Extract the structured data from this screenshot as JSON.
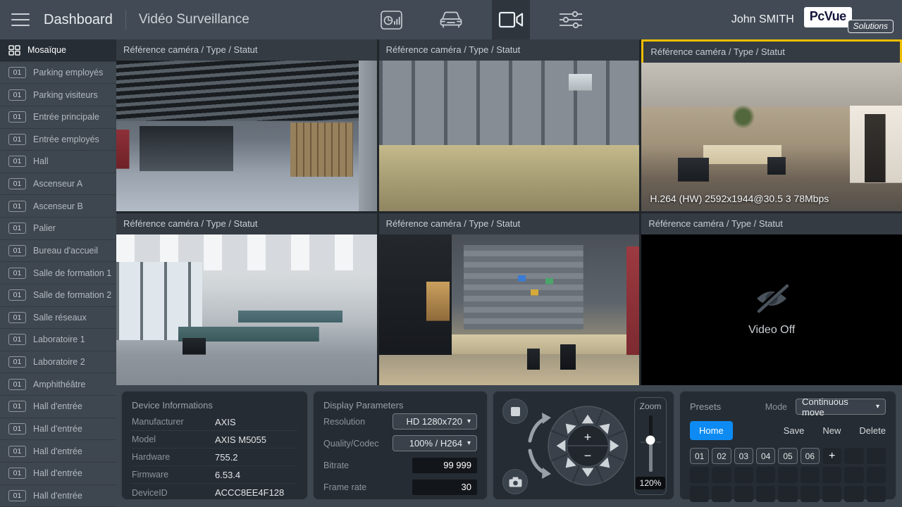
{
  "topbar": {
    "title": "Dashboard",
    "subtitle": "Vidéo Surveillance",
    "user": "John SMITH",
    "logo_primary": "PcVue",
    "logo_secondary": "Solutions",
    "nav_icons": [
      "history-report-icon",
      "vehicle-icon",
      "video-surveillance-icon",
      "settings-sliders-icon"
    ],
    "active_nav": "video-surveillance-icon"
  },
  "sidebar": {
    "items": [
      {
        "label": "Mosaïque",
        "active": true
      },
      {
        "badge": "01",
        "label": "Parking employés"
      },
      {
        "badge": "01",
        "label": "Parking visiteurs"
      },
      {
        "badge": "01",
        "label": "Entrée principale"
      },
      {
        "badge": "01",
        "label": "Entrée employés"
      },
      {
        "badge": "01",
        "label": "Hall"
      },
      {
        "badge": "01",
        "label": "Ascenseur A"
      },
      {
        "badge": "01",
        "label": "Ascenseur B"
      },
      {
        "badge": "01",
        "label": "Palier"
      },
      {
        "badge": "01",
        "label": "Bureau d'accueil"
      },
      {
        "badge": "01",
        "label": "Salle de formation 1"
      },
      {
        "badge": "01",
        "label": "Salle de formation 2"
      },
      {
        "badge": "01",
        "label": "Salle réseaux"
      },
      {
        "badge": "01",
        "label": "Laboratoire 1"
      },
      {
        "badge": "01",
        "label": "Laboratoire 2"
      },
      {
        "badge": "01",
        "label": "Amphithéâtre"
      },
      {
        "badge": "01",
        "label": "Hall d'entrée"
      },
      {
        "badge": "01",
        "label": "Hall d'entrée"
      },
      {
        "badge": "01",
        "label": "Hall d'entrée"
      },
      {
        "badge": "01",
        "label": "Hall d'entrée"
      },
      {
        "badge": "01",
        "label": "Hall d'entrée"
      }
    ]
  },
  "grid": {
    "header": "Référence caméra / Type / Statut",
    "tiles": [
      {
        "scene": "parking-garage"
      },
      {
        "scene": "elevator-cabin"
      },
      {
        "scene": "office-reception",
        "selected": true,
        "overlay": "H.264 (HW) 2592x1944@30.5 3 78Mbps"
      },
      {
        "scene": "training-room"
      },
      {
        "scene": "laboratory"
      },
      {
        "scene": "video-off",
        "label": "Video Off"
      }
    ]
  },
  "device_info": {
    "title": "Device Informations",
    "rows": [
      {
        "label": "Manufacturer",
        "value": "AXIS"
      },
      {
        "label": "Model",
        "value": "AXIS M5055"
      },
      {
        "label": "Hardware",
        "value": "755.2"
      },
      {
        "label": "Firmware",
        "value": "6.53.4"
      },
      {
        "label": "DeviceID",
        "value": "ACCC8EE4F128"
      }
    ]
  },
  "display_params": {
    "title": "Display Parameters",
    "rows": [
      {
        "label": "Resolution",
        "value": "HD 1280x720"
      },
      {
        "label": "Quality/Codec",
        "value": "100% / H264"
      },
      {
        "label": "Bitrate",
        "value": "99 999"
      },
      {
        "label": "Frame rate",
        "value": "30"
      }
    ]
  },
  "ptz": {
    "zoom_label": "Zoom",
    "zoom_value": "120%",
    "zoom_in": "+",
    "zoom_out": "−"
  },
  "presets": {
    "title": "Presets",
    "mode_label": "Mode",
    "mode_value": "Continuous move",
    "home_label": "Home",
    "save_label": "Save",
    "new_label": "New",
    "delete_label": "Delete",
    "slots": [
      "01",
      "02",
      "03",
      "04",
      "05",
      "06"
    ],
    "add_label": "+"
  },
  "colors": {
    "selection_yellow": "#eebe00",
    "home_blue": "#0d8bf2",
    "topbar_bg": "#424b55",
    "panel_bg": "#262c33"
  }
}
